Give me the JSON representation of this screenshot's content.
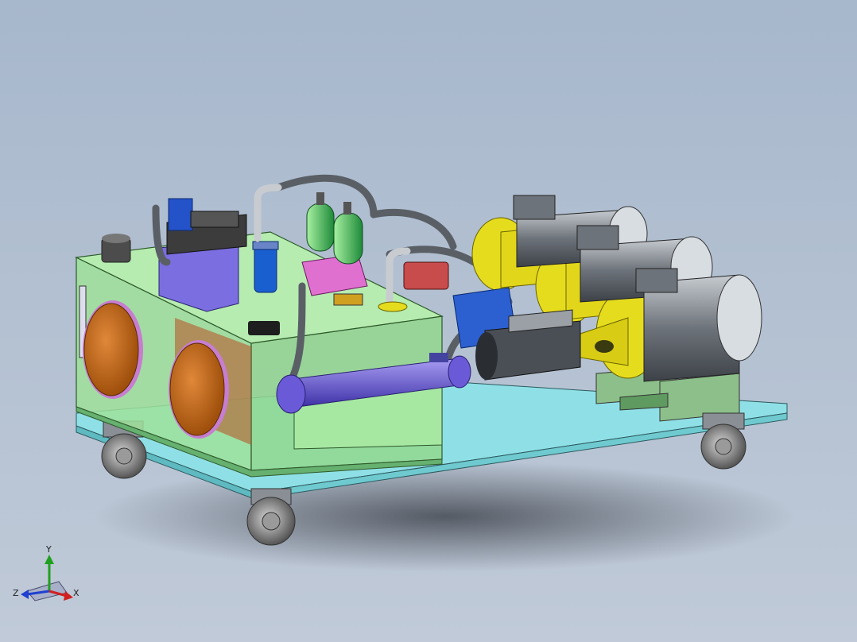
{
  "viewport": {
    "background_top": "#a7b7cc",
    "background_bottom": "#c0cad8"
  },
  "model": {
    "parts": [
      "oil-tank",
      "base-skid",
      "caster-wheel",
      "inspection-cover",
      "valve-manifold",
      "directional-valve",
      "return-filter",
      "accumulator",
      "hydraulic-hose",
      "heat-exchanger",
      "electric-motor",
      "bell-housing",
      "servo-motor",
      "breather-cap"
    ],
    "colors": {
      "tank": "#9fe19a",
      "skid": "#8fe0e6",
      "cover": "#d0711a",
      "manifold": "#7a6ee0",
      "accumulator": "#3ac05a",
      "bell_housing": "#e6dc1e",
      "motor": "#9aa0a6",
      "cooler": "#6a5ad8",
      "filter": "#1a5fd0",
      "pink_block": "#e070d0"
    }
  },
  "triad": {
    "x_label": "X",
    "y_label": "Y",
    "z_label": "Z",
    "x_color": "#d02020",
    "y_color": "#20a020",
    "z_color": "#2040d0"
  }
}
